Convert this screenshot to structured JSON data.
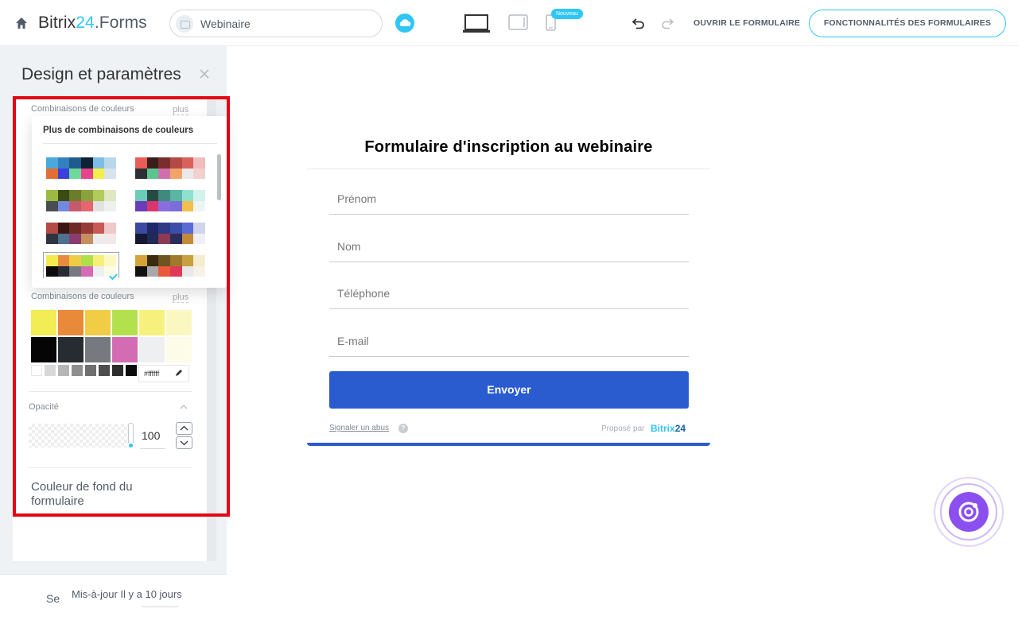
{
  "header": {
    "brand_main": "Bitrix",
    "brand_num": "24",
    "brand_suffix": ".Forms",
    "form_name": "Webinaire",
    "new_badge": "Nouveau",
    "open_form": "OUVRIR LE FORMULAIRE",
    "features": "FONCTIONNALITÉS DES FORMULAIRES"
  },
  "sidebar": {
    "title": "Design et paramètres",
    "section1_label": "Combinaisons de couleurs",
    "section1_plus": "plus",
    "dropdown_title": "Plus de combinaisons de couleurs",
    "palettes": [
      [
        "#4aa8dc",
        "#3380c0",
        "#1f5b8c",
        "#0d2233",
        "#7ebee5",
        "#b8d7ea",
        "#e36e35",
        "#3b3fdd",
        "#6ed99a",
        "#e7428c",
        "#f1ee4e",
        "#dbe3ea"
      ],
      [
        "#e85d57",
        "#3a1e1b",
        "#7a2e2b",
        "#b44a45",
        "#d9625a",
        "#f2bcbc",
        "#2c2f33",
        "#5cc48f",
        "#d16fae",
        "#f2a36b",
        "#e9e9e9",
        "#f3d0d0"
      ],
      [
        "#9cba42",
        "#3c4a14",
        "#6b7c2c",
        "#8aa23e",
        "#b1cc5a",
        "#dfe8c2",
        "#4a4e52",
        "#7189e0",
        "#c65a6c",
        "#e4666e",
        "#e2e2e2",
        "#eef0ec"
      ],
      [
        "#6ccbb9",
        "#264b44",
        "#3f8a7c",
        "#5bb5a3",
        "#8fe0cf",
        "#d2f2ec",
        "#6a3db8",
        "#d9366f",
        "#8a6ee0",
        "#7b6ed6",
        "#f2c04a",
        "#eef6f5"
      ],
      [
        "#b24a45",
        "#3a1715",
        "#6e2a27",
        "#963b37",
        "#c75a55",
        "#efc9c9",
        "#2e3540",
        "#4e7190",
        "#8a3c6c",
        "#c49060",
        "#ececec",
        "#f2e8e8"
      ],
      [
        "#3b4aa0",
        "#1f2866",
        "#2e3a86",
        "#3c4fa8",
        "#5a6bd6",
        "#d0d4ec",
        "#141833",
        "#212a54",
        "#8e3a52",
        "#2c2c5c",
        "#c48a3a",
        "#eef0f6"
      ],
      [
        "#f2ea4f",
        "#e88b3e",
        "#f0cc46",
        "#b1df4b",
        "#f5f07a",
        "#fcf8c2",
        "#0b0b0b",
        "#272b33",
        "#767a80",
        "#d46bb4",
        "#eeeff1",
        "#fbfbe8"
      ],
      [
        "#d4a33a",
        "#3a2a10",
        "#6e5420",
        "#a07a2c",
        "#c8a040",
        "#f6ecd0",
        "#111111",
        "#a8a8a8",
        "#e85a3a",
        "#e03a5a",
        "#e8e8e8",
        "#f6f2e8"
      ]
    ],
    "section2_label": "Combinaisons de couleurs",
    "section2_plus": "plus",
    "swatches_row1": [
      "#f2ec55",
      "#e88a3a",
      "#f1cc45",
      "#b3e14d",
      "#f5f17c",
      "#fbf7c1"
    ],
    "swatches_row2": [
      "#050505",
      "#272b32",
      "#767a80",
      "#d46cb3",
      "#eeeff1",
      "#fcfce9"
    ],
    "grays": [
      "#ffffff",
      "#d8d8d8",
      "#b6b6b6",
      "#8f8f8f",
      "#6f6f6f",
      "#4d4d4d",
      "#2d2d2d",
      "#0b0b0b"
    ],
    "hex_value": "#ffffff",
    "opacity_label": "Opacité",
    "opacity_value": "100",
    "bg_color_label": "Couleur de fond du formulaire",
    "save_partial": "Se",
    "updated": "Mis-à-jour Il y a 10 jours"
  },
  "form": {
    "title": "Formulaire d'inscription au webinaire",
    "fields": [
      "Prénom",
      "Nom",
      "Téléphone",
      "E-mail"
    ],
    "submit": "Envoyer",
    "report_abuse": "Signaler un abus",
    "powered_by": "Proposé par",
    "brand_bx": "Bitrix",
    "brand_num": "24"
  },
  "colors": {
    "accent": "#2fc6f6",
    "button": "#2a5bcf",
    "highlight_frame": "#e30613"
  }
}
